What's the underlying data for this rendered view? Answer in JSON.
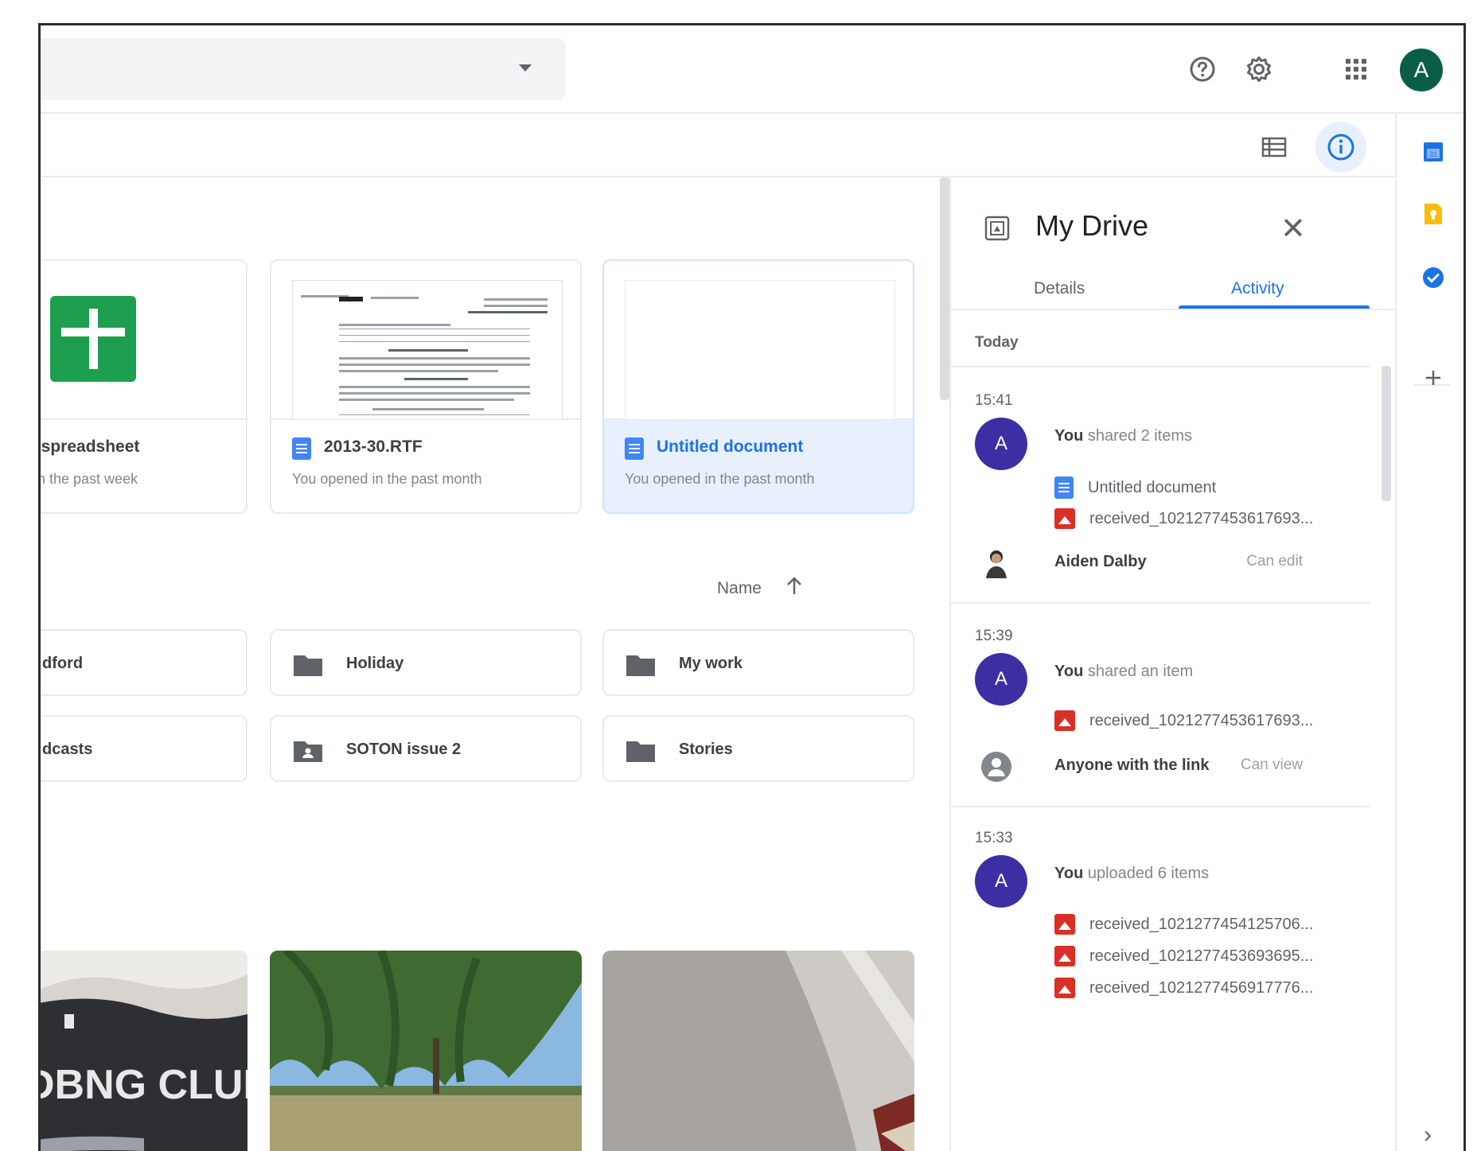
{
  "header": {
    "help_icon": "help-circle-icon",
    "settings_icon": "gear-icon",
    "apps_icon": "apps-grid-icon",
    "account_initial": "A",
    "account_color": "#0b5e46"
  },
  "toolbar": {
    "list_view_icon": "list-view-icon",
    "info_icon": "info-icon"
  },
  "quick_access": [
    {
      "name": "d spreadsheet",
      "subtitle": "I in the past week",
      "type": "spreadsheet"
    },
    {
      "name": "2013-30.RTF",
      "subtitle": "You opened in the past month",
      "type": "document"
    },
    {
      "name": "Untitled document",
      "subtitle": "You opened in the past month",
      "type": "document",
      "selected": true
    }
  ],
  "sort": {
    "label": "Name",
    "direction_icon": "arrow-up-icon"
  },
  "folders": [
    {
      "name": "dford",
      "shared": false
    },
    {
      "name": "Holiday",
      "shared": false
    },
    {
      "name": "My work",
      "shared": false
    },
    {
      "name": "dcasts",
      "shared": false
    },
    {
      "name": "SOTON issue 2",
      "shared": true
    },
    {
      "name": "Stories",
      "shared": false
    }
  ],
  "photos": [
    {
      "text": "DBNG CLUB"
    },
    {
      "text": ""
    },
    {
      "text": ""
    }
  ],
  "panel": {
    "title": "My Drive",
    "tabs": [
      "Details",
      "Activity"
    ],
    "active_tab": "Activity",
    "section": "Today",
    "activities": [
      {
        "time": "15:41",
        "avatar": "A",
        "actor": "You",
        "action": "shared 2 items",
        "files": [
          {
            "name": "Untitled document",
            "type": "doc"
          },
          {
            "name": "received_1021277453617693...",
            "type": "image"
          }
        ],
        "person": {
          "name": "Aiden Dalby",
          "role": "Can edit"
        }
      },
      {
        "time": "15:39",
        "avatar": "A",
        "actor": "You",
        "action": "shared an item",
        "files": [
          {
            "name": "received_1021277453617693...",
            "type": "image"
          }
        ],
        "person": {
          "name": "Anyone with the link",
          "role": "Can view"
        }
      },
      {
        "time": "15:33",
        "avatar": "A",
        "actor": "You",
        "action": "uploaded 6 items",
        "files": [
          {
            "name": "received_1021277454125706...",
            "type": "image"
          },
          {
            "name": "received_1021277453693695...",
            "type": "image"
          },
          {
            "name": "received_1021277456917776...",
            "type": "image"
          }
        ]
      }
    ]
  },
  "side_rail": [
    "calendar-icon",
    "keep-icon",
    "tasks-icon",
    "add-icon"
  ],
  "colors": {
    "accent": "#1a73e8",
    "activity_avatar": "#3b2fa3",
    "sheets_green": "#1e9e4f",
    "image_red": "#d93025",
    "docs_blue": "#4285f4"
  }
}
